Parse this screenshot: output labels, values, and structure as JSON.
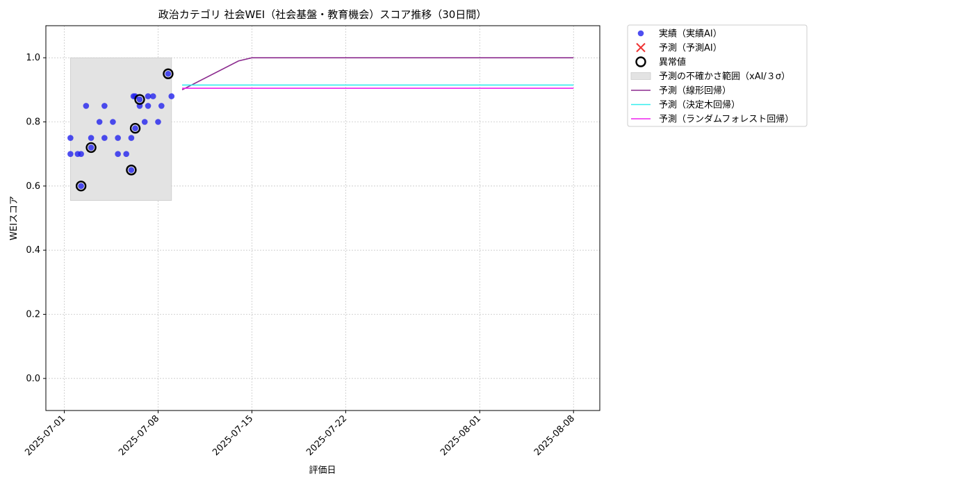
{
  "chart_data": {
    "type": "scatter",
    "title": "政治カテゴリ 社会WEI（社会基盤・教育機会）スコア推移（30日間）",
    "xlabel": "評価日",
    "ylabel": "WEIスコア",
    "xlim": [
      "2025-06-29T15:00",
      "2025-08-09T23:00"
    ],
    "ylim": [
      -0.1,
      1.1
    ],
    "x_ticks": [
      "2025-07-01",
      "2025-07-08",
      "2025-07-15",
      "2025-07-22",
      "2025-08-01",
      "2025-08-08"
    ],
    "y_ticks": [
      0.0,
      0.2,
      0.4,
      0.6,
      0.8,
      1.0
    ],
    "grid": true,
    "legend_placement": "outside upper-right",
    "series": [
      {
        "name": "実績（実績AI）",
        "kind": "scatter",
        "color": "#2222ee",
        "points": [
          [
            "2025-07-01T11:00",
            0.75
          ],
          [
            "2025-07-01T11:00",
            0.7
          ],
          [
            "2025-07-02T00:00",
            0.7
          ],
          [
            "2025-07-02T06:00",
            0.7
          ],
          [
            "2025-07-02T06:00",
            0.6
          ],
          [
            "2025-07-02T15:00",
            0.85
          ],
          [
            "2025-07-03T00:00",
            0.75
          ],
          [
            "2025-07-03T00:00",
            0.72
          ],
          [
            "2025-07-03T15:00",
            0.8
          ],
          [
            "2025-07-04T00:00",
            0.85
          ],
          [
            "2025-07-04T00:00",
            0.75
          ],
          [
            "2025-07-04T15:00",
            0.8
          ],
          [
            "2025-07-05T00:00",
            0.7
          ],
          [
            "2025-07-05T00:00",
            0.75
          ],
          [
            "2025-07-05T15:00",
            0.7
          ],
          [
            "2025-07-06T00:00",
            0.75
          ],
          [
            "2025-07-06T00:00",
            0.65
          ],
          [
            "2025-07-06T04:00",
            0.88
          ],
          [
            "2025-07-06T07:00",
            0.88
          ],
          [
            "2025-07-06T07:00",
            0.78
          ],
          [
            "2025-07-06T15:00",
            0.87
          ],
          [
            "2025-07-06T15:00",
            0.85
          ],
          [
            "2025-07-07T00:00",
            0.8
          ],
          [
            "2025-07-07T06:00",
            0.85
          ],
          [
            "2025-07-07T06:00",
            0.88
          ],
          [
            "2025-07-07T15:00",
            0.88
          ],
          [
            "2025-07-08T00:00",
            0.8
          ],
          [
            "2025-07-08T06:00",
            0.85
          ],
          [
            "2025-07-08T18:00",
            0.95
          ],
          [
            "2025-07-09T00:00",
            0.88
          ]
        ]
      },
      {
        "name": "予測（予測AI）",
        "kind": "marker",
        "color": "#ee3333",
        "points": []
      },
      {
        "name": "異常値",
        "kind": "ring",
        "color": "#000000",
        "points": [
          [
            "2025-07-02T06:00",
            0.6
          ],
          [
            "2025-07-03T00:00",
            0.72
          ],
          [
            "2025-07-06T00:00",
            0.65
          ],
          [
            "2025-07-06T07:00",
            0.78
          ],
          [
            "2025-07-06T15:00",
            0.87
          ],
          [
            "2025-07-08T18:00",
            0.95
          ]
        ]
      },
      {
        "name": "予測の不確かさ範囲（xAI/３σ）",
        "kind": "band",
        "color": "#e3e3e3",
        "x_start": "2025-07-01T11:00",
        "x_end": "2025-07-09T00:00",
        "y_low": 0.555,
        "y_high": 1.0
      },
      {
        "name": "予測（線形回帰）",
        "kind": "line",
        "color": "#8b2a8e",
        "points": [
          [
            "2025-07-09T19:00",
            0.9
          ],
          [
            "2025-07-14T00:00",
            0.99
          ],
          [
            "2025-07-15T00:00",
            1.0
          ],
          [
            "2025-08-08T00:00",
            1.0
          ]
        ]
      },
      {
        "name": "予測（決定木回帰）",
        "kind": "line",
        "color": "#33eeee",
        "points": [
          [
            "2025-07-09T19:00",
            0.915
          ],
          [
            "2025-08-08T00:00",
            0.915
          ]
        ]
      },
      {
        "name": "予測（ランダムフォレスト回帰）",
        "kind": "line",
        "color": "#ee22ee",
        "points": [
          [
            "2025-07-09T19:00",
            0.905
          ],
          [
            "2025-08-08T00:00",
            0.905
          ]
        ]
      }
    ]
  }
}
